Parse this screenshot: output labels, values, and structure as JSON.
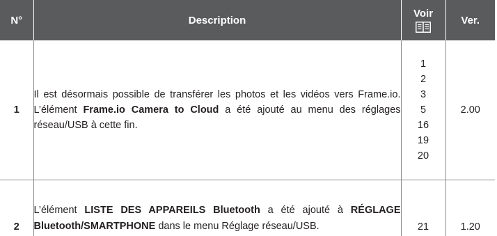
{
  "table": {
    "headers": {
      "num": "N°",
      "description": "Description",
      "voir": "Voir",
      "voir_icon": "book-icon",
      "ver": "Ver."
    },
    "rows": [
      {
        "num": "1",
        "description_parts": [
          "Il est désormais possible de transférer les photos et les vidéos vers Frame.io. L’élément ",
          "Frame.io Camera to Cloud",
          " a été ajouté au menu des réglages réseau/USB à cette fin."
        ],
        "pages": [
          "1",
          "2",
          "3",
          "5",
          "16",
          "19",
          "20"
        ],
        "ver": "2.00"
      },
      {
        "num": "2",
        "description_parts": [
          "L’élément ",
          "LISTE DES APPAREILS Bluetooth",
          " a été ajouté à ",
          "RÉGLAGE Bluetooth/SMARTPHONE",
          " dans le menu Réglage réseau/USB."
        ],
        "pages": [
          "21"
        ],
        "ver": "1.20"
      }
    ]
  },
  "colors": {
    "header_bg": "#5a5b5d",
    "header_text": "#ffffff",
    "body_text": "#231f20",
    "rule": "#8a8a8a"
  }
}
